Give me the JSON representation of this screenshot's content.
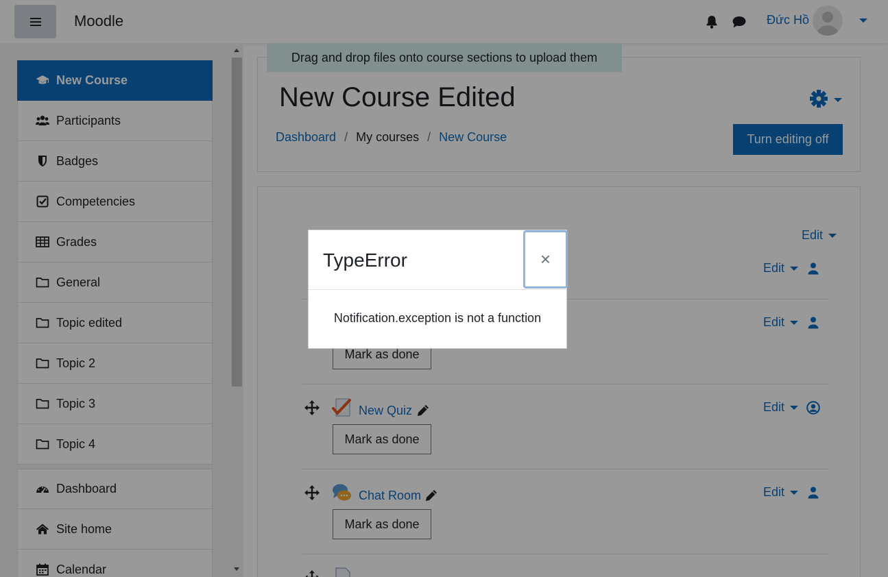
{
  "navbar": {
    "brand": "Moodle",
    "user_name": "Đức Hồ"
  },
  "drawer": {
    "items": [
      {
        "label": "New Course",
        "icon": "graduation-cap-icon",
        "active": true
      },
      {
        "label": "Participants",
        "icon": "users-icon"
      },
      {
        "label": "Badges",
        "icon": "shield-icon"
      },
      {
        "label": "Competencies",
        "icon": "check-square-icon"
      },
      {
        "label": "Grades",
        "icon": "table-icon"
      },
      {
        "label": "General",
        "icon": "folder-icon"
      },
      {
        "label": "Topic edited",
        "icon": "folder-icon"
      },
      {
        "label": "Topic 2",
        "icon": "folder-icon"
      },
      {
        "label": "Topic 3",
        "icon": "folder-icon"
      },
      {
        "label": "Topic 4",
        "icon": "folder-icon"
      }
    ],
    "items2": [
      {
        "label": "Dashboard",
        "icon": "tachometer-icon"
      },
      {
        "label": "Site home",
        "icon": "home-icon"
      },
      {
        "label": "Calendar",
        "icon": "calendar-icon"
      }
    ]
  },
  "header": {
    "dnd_banner": "Drag and drop files onto course sections to upload them",
    "course_title": "New Course Edited",
    "breadcrumb": [
      "Dashboard",
      "My courses",
      "New Course"
    ],
    "separator": "/",
    "edit_toggle": "Turn editing off"
  },
  "content": {
    "edit_label": "Edit",
    "mark_done_label": "Mark as done",
    "activities": [
      {
        "name": "New Quiz",
        "icon": "quiz-icon"
      },
      {
        "name": "Chat Room",
        "icon": "chat-room-icon"
      }
    ]
  },
  "modal": {
    "title": "TypeError",
    "close": "×",
    "message": "Notification.exception is not a function"
  },
  "colors": {
    "brand_blue": "#0f6cbf",
    "banner_bg": "#d8eeed"
  }
}
